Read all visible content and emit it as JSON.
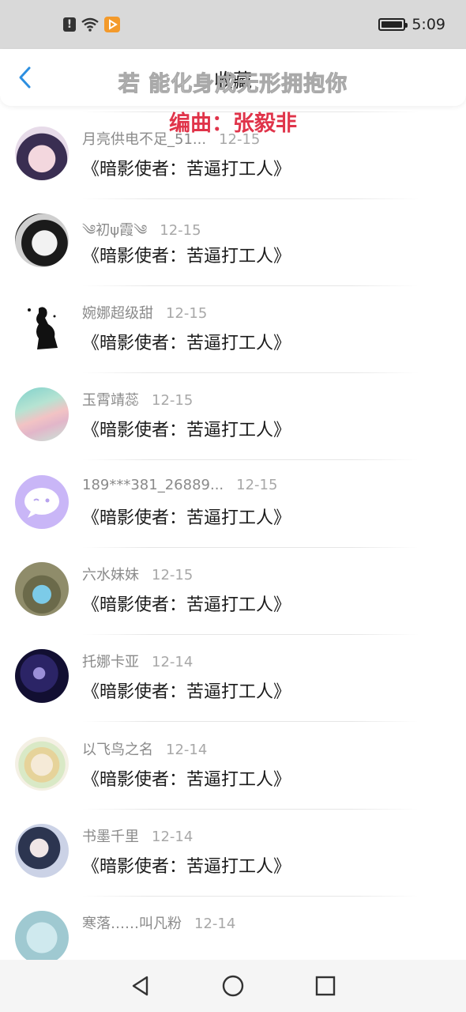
{
  "status_bar": {
    "time": "5:09",
    "icons": [
      "alert-icon",
      "wifi-icon",
      "video-play-icon",
      "battery-icon"
    ]
  },
  "header": {
    "title": "收藏",
    "back_icon": "chevron-left-icon",
    "accent_color": "#2d8fe0"
  },
  "lyrics": {
    "line1": "若 能化身成无形拥抱你",
    "line2": "编曲：张毅非",
    "line2_color": "#e0344a"
  },
  "comments": [
    {
      "username": "",
      "date": "",
      "text": "《暗影使者：苦逼打工人》",
      "avatar": "dark"
    },
    {
      "username": "月亮供电不足_51...",
      "date": "12-15",
      "text": "《暗影使者：苦逼打工人》",
      "avatar": "anime-girl-dark-hair"
    },
    {
      "username": "༄初ψ霞༄",
      "date": "12-15",
      "text": "《暗影使者：苦逼打工人》",
      "avatar": "bw-anime-girl"
    },
    {
      "username": "婉娜超级甜",
      "date": "12-15",
      "text": "《暗影使者：苦逼打工人》",
      "avatar": "silhouette"
    },
    {
      "username": "玉霄靖蕊",
      "date": "12-15",
      "text": "《暗影使者：苦逼打工人》",
      "avatar": "pastel-landscape"
    },
    {
      "username": "189***381_26889...",
      "date": "12-15",
      "text": "《暗影使者：苦逼打工人》",
      "avatar": "default-chat-bubble"
    },
    {
      "username": "六水妹妹",
      "date": "12-15",
      "text": "《暗影使者：苦逼打工人》",
      "avatar": "girl-blue-dress"
    },
    {
      "username": "托娜卡亚",
      "date": "12-14",
      "text": "《暗影使者：苦逼打工人》",
      "avatar": "anime-dark-purple"
    },
    {
      "username": "以飞鸟之名",
      "date": "12-14",
      "text": "《暗影使者：苦逼打工人》",
      "avatar": "anime-flower-girl"
    },
    {
      "username": "书墨千里",
      "date": "12-14",
      "text": "《暗影使者：苦逼打工人》",
      "avatar": "anime-boy"
    },
    {
      "username": "寒落……叫凡粉",
      "date": "12-14",
      "text": "",
      "avatar": "partial"
    }
  ],
  "nav_bar": {
    "icons": [
      "back-triangle-icon",
      "home-circle-icon",
      "recents-square-icon"
    ]
  }
}
